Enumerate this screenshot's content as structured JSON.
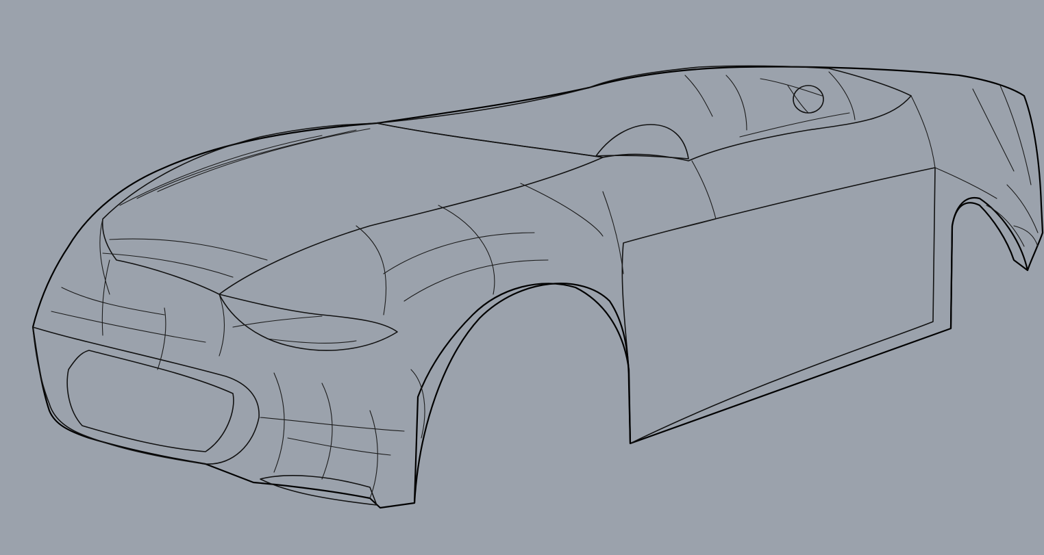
{
  "viewport": {
    "background_color": "#9ba2ac",
    "shading_mode": "shaded-with-isocurves",
    "model": "car-body-surface",
    "surface_color": "#f2f2f2",
    "edge_color": "#111111"
  }
}
